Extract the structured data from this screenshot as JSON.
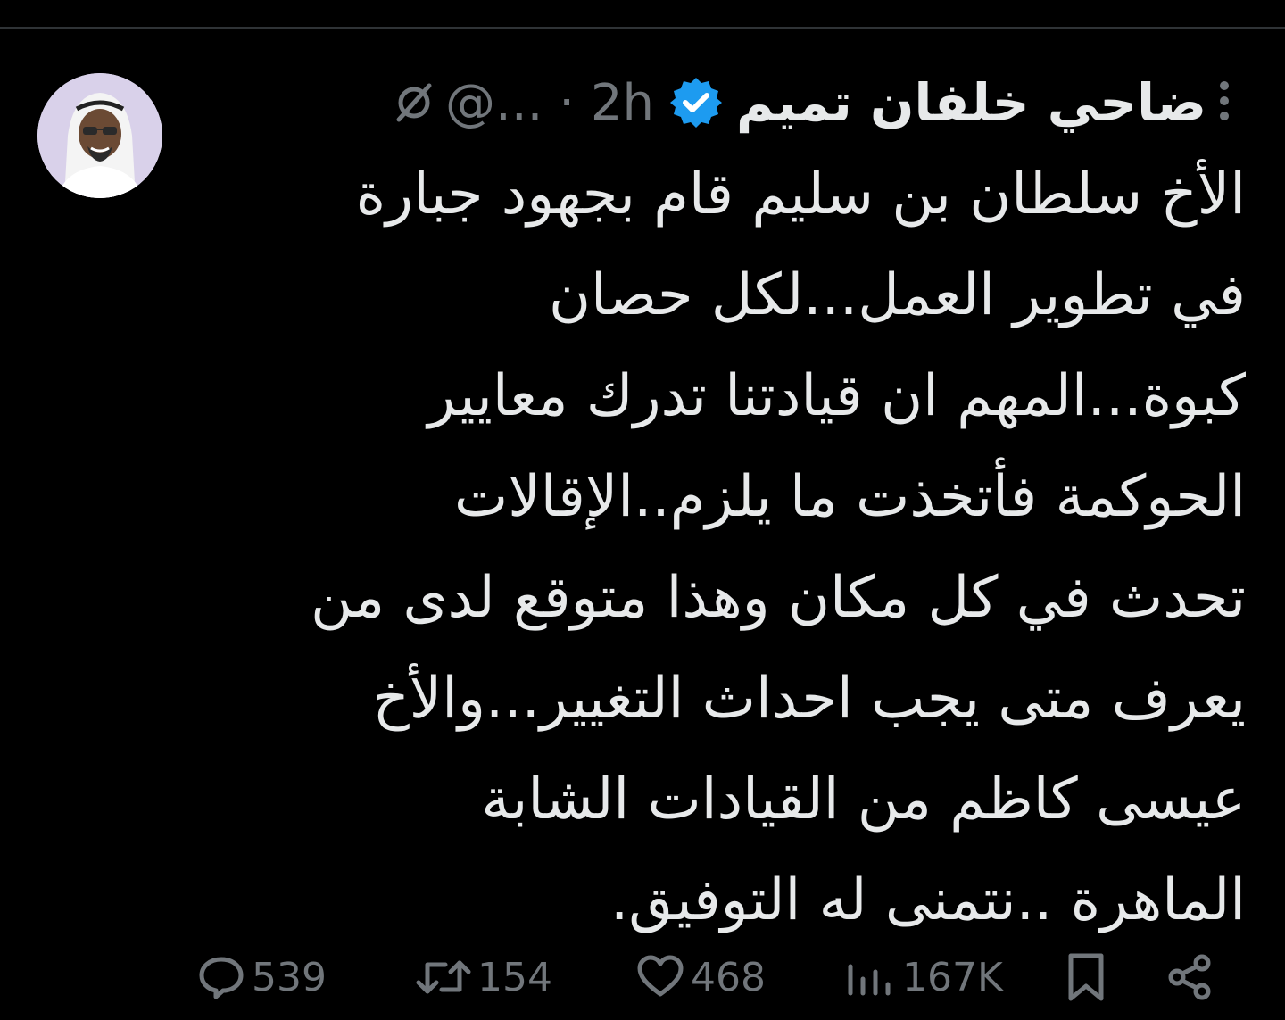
{
  "tweet": {
    "author_name": "ضاحي خلفان تميم",
    "handle": "@...",
    "separator": "·",
    "time": "2h",
    "text": "الأخ سلطان بن سليم قام بجهود جبارة\nفي تطوير العمل...لكل حصان\nكبوة...المهم ان قيادتنا تدرك معايير\nالحوكمة فأتخذت ما يلزم..الإقالات\nتحدث في كل مكان وهذا متوقع لدى من\nيعرف متى يجب احداث التغيير...والأخ\nعيسى كاظم من القيادات الشابة\nالماهرة ..نتمنى له التوفيق."
  },
  "icons": {
    "verified": "verified-badge-icon",
    "edit": "edit-slash-icon",
    "more": "more-dots-icon",
    "reply": "reply-icon",
    "retweet": "retweet-icon",
    "like": "heart-icon",
    "views": "views-icon",
    "bookmark": "bookmark-icon",
    "share": "share-icon"
  },
  "actions": {
    "replies": "539",
    "retweets": "154",
    "likes": "468",
    "views": "167K"
  },
  "colors": {
    "background": "#000000",
    "text": "#e7e9ea",
    "muted": "#71767b",
    "verified": "#1d9bf0"
  }
}
